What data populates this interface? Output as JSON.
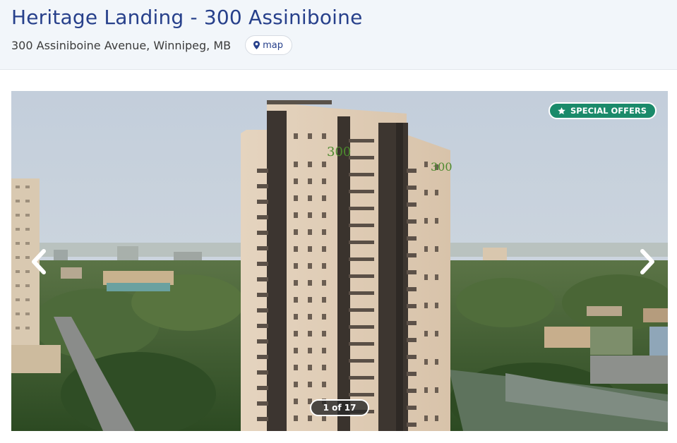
{
  "property": {
    "title": "Heritage Landing - 300 Assiniboine",
    "address": "300 Assiniboine Avenue, Winnipeg, MB",
    "map_label": "map"
  },
  "gallery": {
    "badge_label": "SPECIAL OFFERS",
    "counter_text": "1 of 17",
    "building_sign": "300",
    "current_index": 1,
    "total_images": 17
  },
  "colors": {
    "title": "#27408b",
    "badge": "#1a8a6a",
    "header_bg": "#f2f6fa"
  },
  "icons": {
    "map": "map-pin-icon",
    "badge": "star-icon",
    "prev": "chevron-left-icon",
    "next": "chevron-right-icon"
  }
}
